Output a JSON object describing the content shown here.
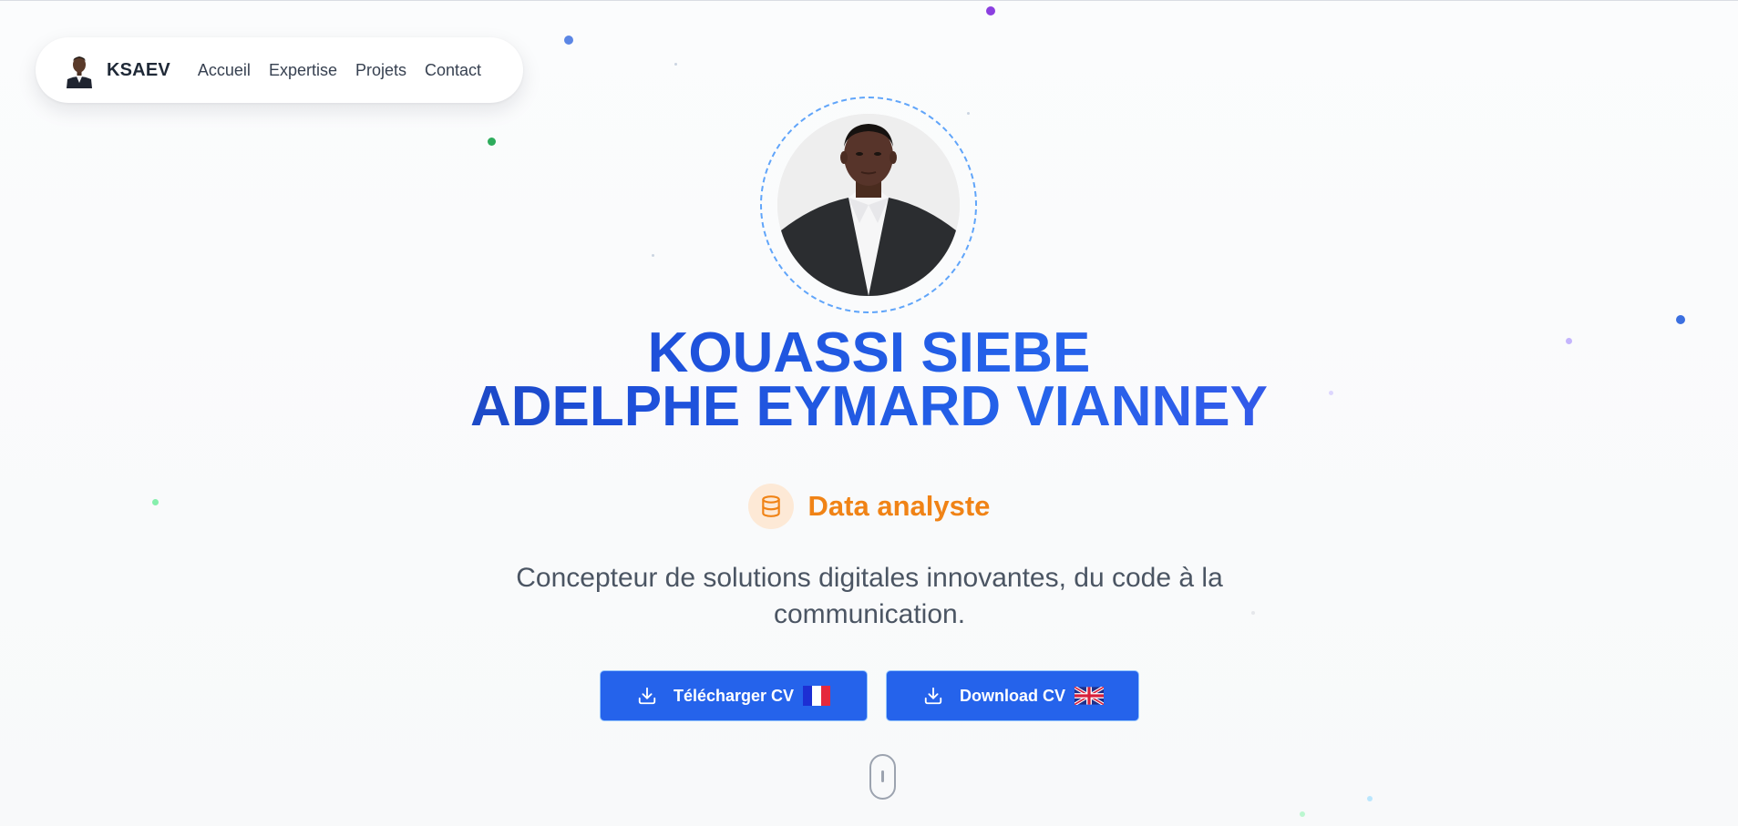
{
  "navbar": {
    "brand": "KSAEV",
    "links": [
      "Accueil",
      "Expertise",
      "Projets",
      "Contact"
    ]
  },
  "hero": {
    "name_line1": "KOUASSI SIEBE",
    "name_line2": "ADELPHE EYMARD VIANNEY",
    "role": "Data analyste",
    "role_icon": "database-icon",
    "tagline": "Concepteur de solutions digitales innovantes, du code à la communication.",
    "buttons": {
      "cv_fr": "Télécharger CV",
      "cv_en": "Download CV"
    }
  },
  "colors": {
    "accent": "#2563eb",
    "title_gradient_start": "#1e3a8a",
    "title_gradient_end": "#4f46e5",
    "role": "#f08316",
    "portrait_ring": "#60a5fa"
  }
}
